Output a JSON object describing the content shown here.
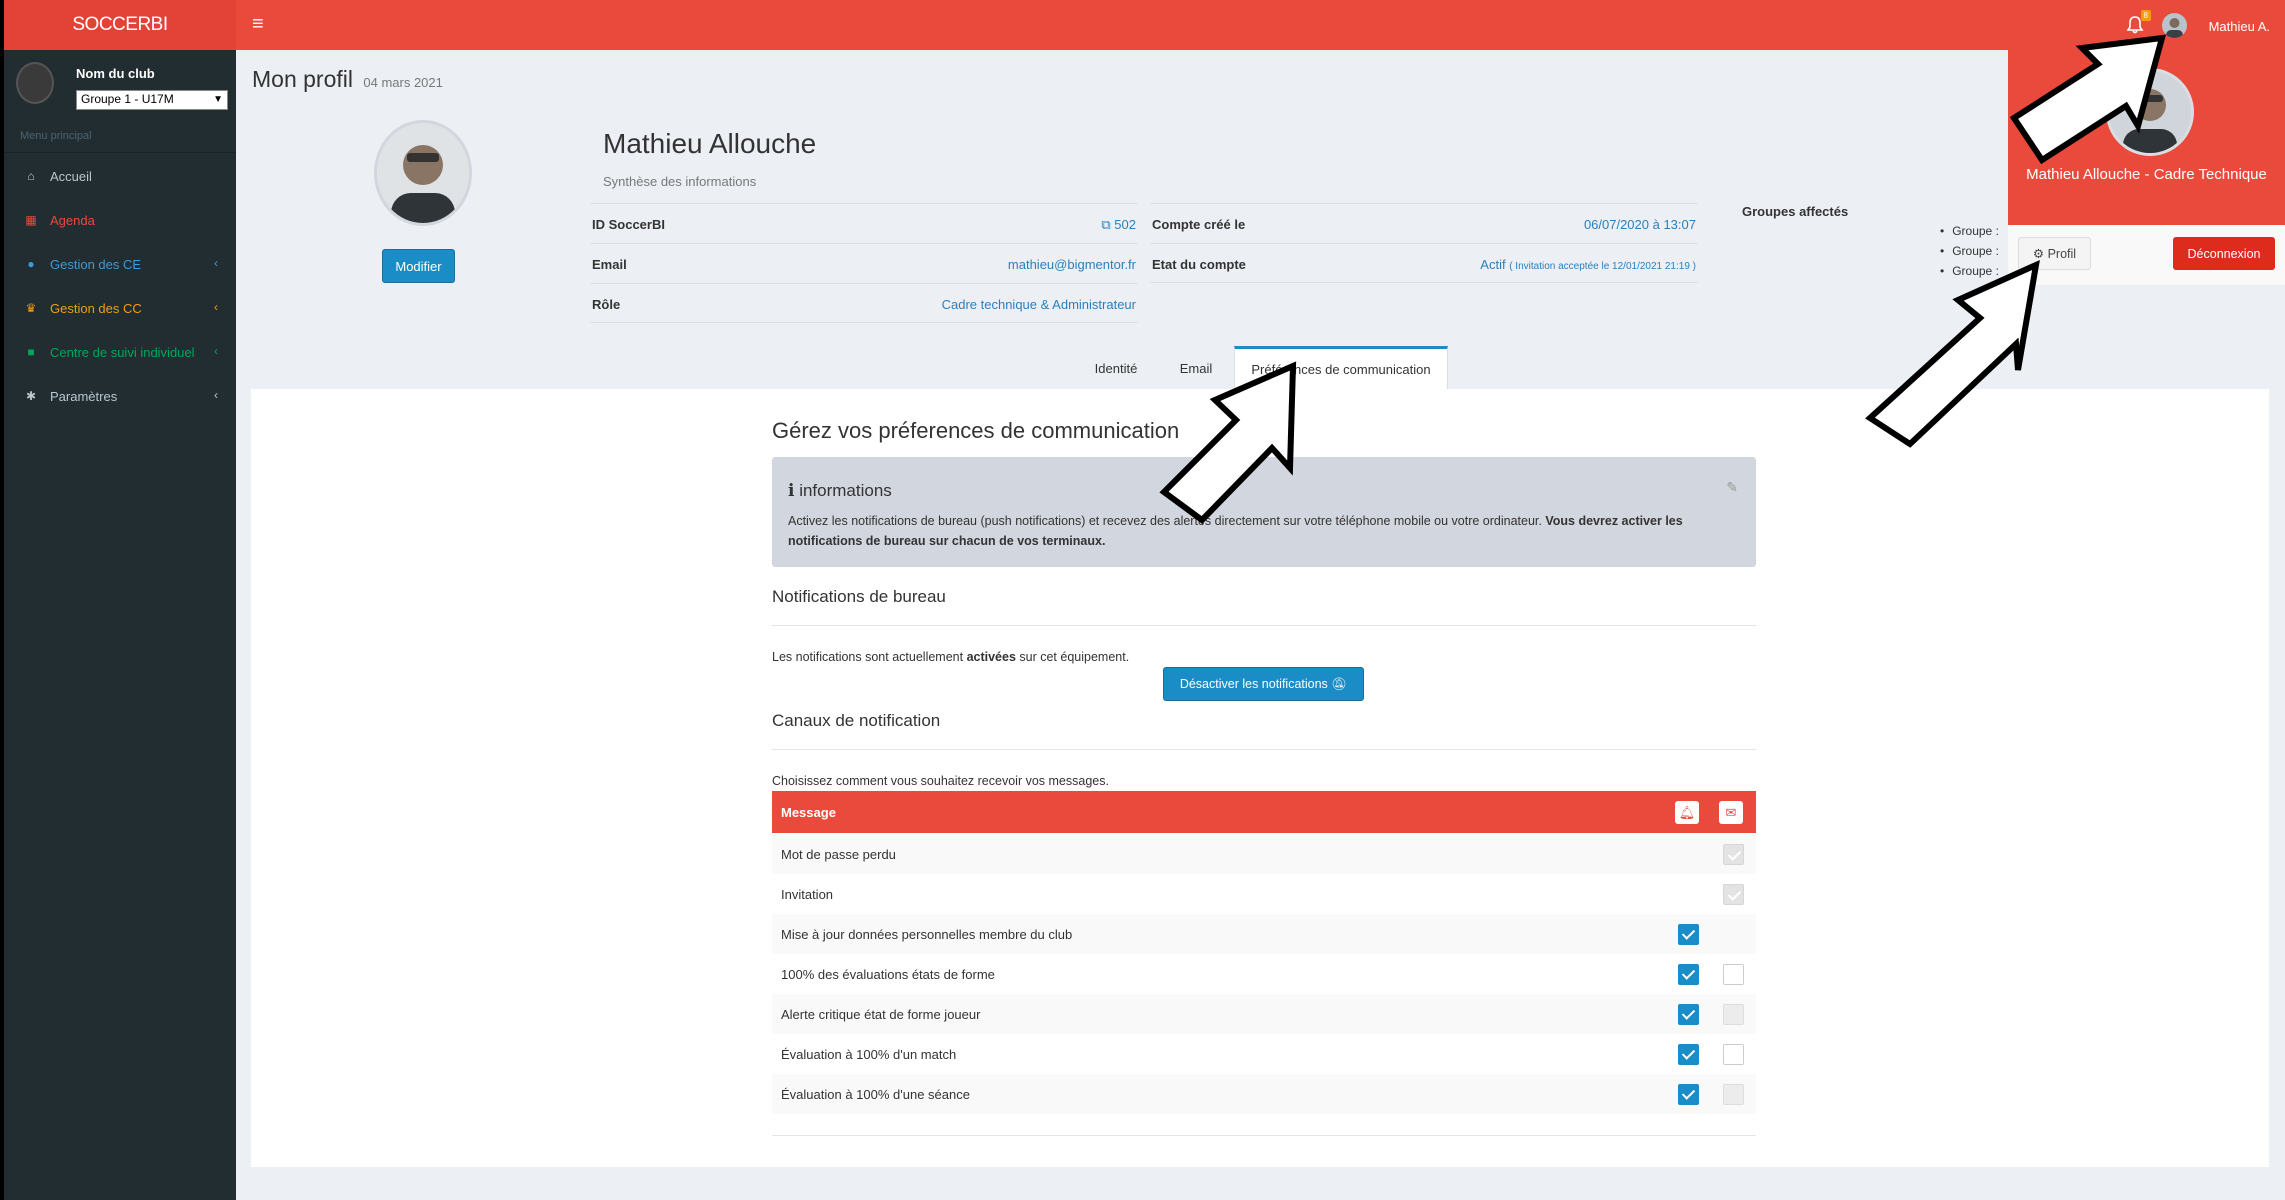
{
  "app": {
    "logo": "SOCCERBI"
  },
  "topbar": {
    "notif_count": "8",
    "user_name": "Mathieu A."
  },
  "sidebar": {
    "club_name": "Nom du club",
    "club_select": "Groupe 1 - U17M",
    "menu_header": "Menu principal",
    "items": [
      {
        "label": "Accueil",
        "color": "#b8c7ce"
      },
      {
        "label": "Agenda",
        "color": "#e94a3c"
      },
      {
        "label": "Gestion des CE",
        "color": "#3c9bd9"
      },
      {
        "label": "Gestion des CC",
        "color": "#f39c12"
      },
      {
        "label": "Centre de suivi individuel",
        "color": "#00a65a"
      },
      {
        "label": "Paramètres",
        "color": "#b8c7ce"
      }
    ]
  },
  "page": {
    "title": "Mon profil",
    "date": "04 mars 2021"
  },
  "profile": {
    "modify_label": "Modifier",
    "name": "Mathieu Allouche",
    "subtitle": "Synthèse des informations",
    "id_label": "ID SoccerBI",
    "id_value": "502",
    "email_label": "Email",
    "email_value": "mathieu@bigmentor.fr",
    "role_label": "Rôle",
    "role_value": "Cadre technique & Administrateur",
    "created_label": "Compte créé le",
    "created_value": "06/07/2020 à 13:07",
    "state_label": "Etat du compte",
    "state_value": "Actif",
    "state_note": "( Invitation acceptée le 12/01/2021 21:19 )",
    "groups_label": "Groupes affectés",
    "groups": [
      "Groupe :",
      "Groupe :",
      "Groupe :"
    ]
  },
  "tabs": [
    "Identité",
    "Email",
    "Préférences de communication"
  ],
  "prefs": {
    "title": "Gérez vos préferences de communication",
    "info_title": "informations",
    "info_text_1": "Activez les notifications de bureau (push notifications) et recevez des alertes directement sur votre téléphone mobile ou votre ordinateur. ",
    "info_text_2": "Vous devrez activer les notifications de bureau sur chacun de vos terminaux.",
    "desktop_title": "Notifications de bureau",
    "desktop_text_1": "Les notifications sont actuellement ",
    "desktop_text_bold": "activées",
    "desktop_text_2": " sur cet équipement.",
    "deactivate_label": "Désactiver les notifications",
    "channels_title": "Canaux de notification",
    "channels_text": "Choisissez comment vous souhaitez recevoir vos messages.",
    "table_header": "Message",
    "rows": [
      {
        "label": "Mot de passe perdu",
        "push": "none",
        "mail": "disabled-checked"
      },
      {
        "label": "Invitation",
        "push": "none",
        "mail": "disabled-checked"
      },
      {
        "label": "Mise à jour données personnelles membre du club",
        "push": "checked",
        "mail": "none"
      },
      {
        "label": "100% des évaluations états de forme",
        "push": "checked",
        "mail": "unchecked"
      },
      {
        "label": "Alerte critique état de forme joueur",
        "push": "checked",
        "mail": "disabled-unchecked"
      },
      {
        "label": "Évaluation à 100% d'un match",
        "push": "checked",
        "mail": "unchecked"
      },
      {
        "label": "Évaluation à 100% d'une séance",
        "push": "checked",
        "mail": "disabled-unchecked"
      }
    ]
  },
  "dropdown": {
    "name": "Mathieu Allouche - Cadre Technique",
    "profile_label": "Profil",
    "logout_label": "Déconnexion"
  },
  "colors": {
    "brand": "#e94a3c",
    "primary": "#1a8cc6",
    "sidebar": "#222d32"
  }
}
